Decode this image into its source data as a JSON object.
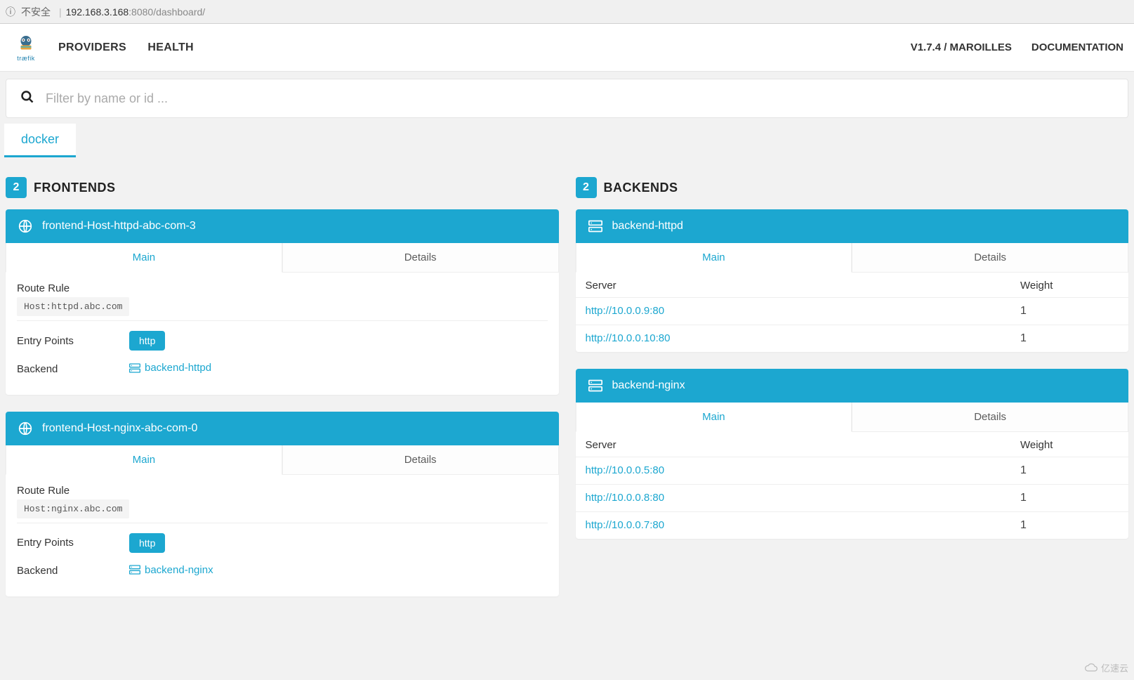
{
  "browser": {
    "insecure_label": "不安全",
    "url_host": "192.168.3.168",
    "url_port_path": ":8080/dashboard/"
  },
  "nav": {
    "providers": "PROVIDERS",
    "health": "HEALTH",
    "version": "V1.7.4 / MAROILLES",
    "documentation": "DOCUMENTATION",
    "logo_text": "træfik"
  },
  "search": {
    "placeholder": "Filter by name or id ..."
  },
  "provider_tab": "docker",
  "frontends": {
    "count": "2",
    "title": "FRONTENDS",
    "tabs": {
      "main": "Main",
      "details": "Details"
    },
    "labels": {
      "route_rule": "Route Rule",
      "entry_points": "Entry Points",
      "backend": "Backend"
    },
    "cards": [
      {
        "name": "frontend-Host-httpd-abc-com-3",
        "rule": "Host:httpd.abc.com",
        "entry_chip": "http",
        "backend": "backend-httpd"
      },
      {
        "name": "frontend-Host-nginx-abc-com-0",
        "rule": "Host:nginx.abc.com",
        "entry_chip": "http",
        "backend": "backend-nginx"
      }
    ]
  },
  "backends": {
    "count": "2",
    "title": "BACKENDS",
    "tabs": {
      "main": "Main",
      "details": "Details"
    },
    "headers": {
      "server": "Server",
      "weight": "Weight"
    },
    "cards": [
      {
        "name": "backend-httpd",
        "servers": [
          {
            "url": "http://10.0.0.9:80",
            "weight": "1"
          },
          {
            "url": "http://10.0.0.10:80",
            "weight": "1"
          }
        ]
      },
      {
        "name": "backend-nginx",
        "servers": [
          {
            "url": "http://10.0.0.5:80",
            "weight": "1"
          },
          {
            "url": "http://10.0.0.8:80",
            "weight": "1"
          },
          {
            "url": "http://10.0.0.7:80",
            "weight": "1"
          }
        ]
      }
    ]
  },
  "watermark": "亿速云"
}
